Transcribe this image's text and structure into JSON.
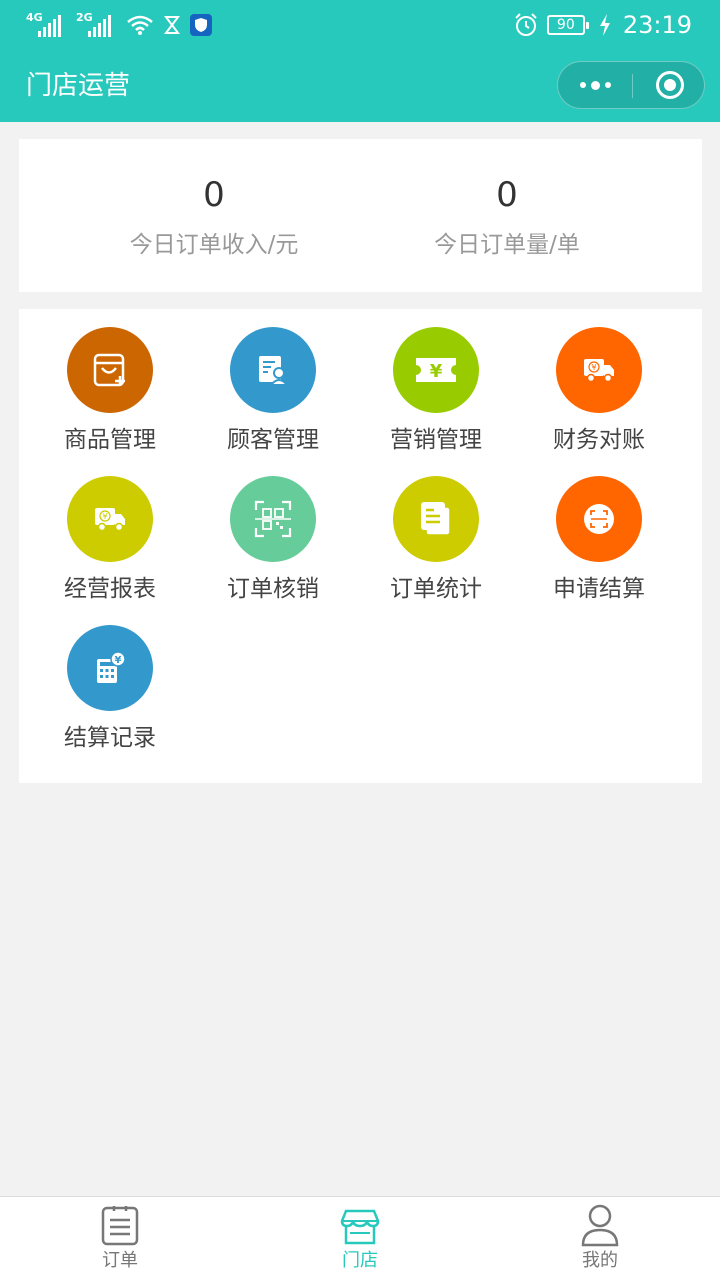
{
  "status_bar": {
    "net1": "4G",
    "net2": "2G",
    "battery": "90",
    "time": "23:19"
  },
  "nav": {
    "title": "门店运营"
  },
  "stats": [
    {
      "value": "0",
      "label": "今日订单收入/元"
    },
    {
      "value": "0",
      "label": "今日订单量/单"
    }
  ],
  "menu": {
    "items": [
      {
        "label": "商品管理",
        "icon": "shopping-bag-plus-icon",
        "color": "#cc6600"
      },
      {
        "label": "顾客管理",
        "icon": "customer-card-icon",
        "color": "#3399cc"
      },
      {
        "label": "营销管理",
        "icon": "yuan-ticket-icon",
        "color": "#99cc00"
      },
      {
        "label": "财务对账",
        "icon": "delivery-truck-icon",
        "color": "#ff6600"
      },
      {
        "label": "经营报表",
        "icon": "delivery-truck-icon",
        "color": "#cccc00"
      },
      {
        "label": "订单核销",
        "icon": "qr-scan-icon",
        "color": "#66cc99"
      },
      {
        "label": "订单统计",
        "icon": "documents-icon",
        "color": "#cccc00"
      },
      {
        "label": "申请结算",
        "icon": "scan-frame-icon",
        "color": "#ff6600"
      },
      {
        "label": "结算记录",
        "icon": "calculator-yuan-icon",
        "color": "#3399cc"
      }
    ]
  },
  "tabbar": {
    "tabs": [
      {
        "label": "订单",
        "icon": "clipboard-icon",
        "active": false
      },
      {
        "label": "门店",
        "icon": "store-icon",
        "active": true
      },
      {
        "label": "我的",
        "icon": "user-icon",
        "active": false
      }
    ]
  },
  "colors": {
    "brand": "#27c9bd",
    "background": "#f2f2f2"
  }
}
